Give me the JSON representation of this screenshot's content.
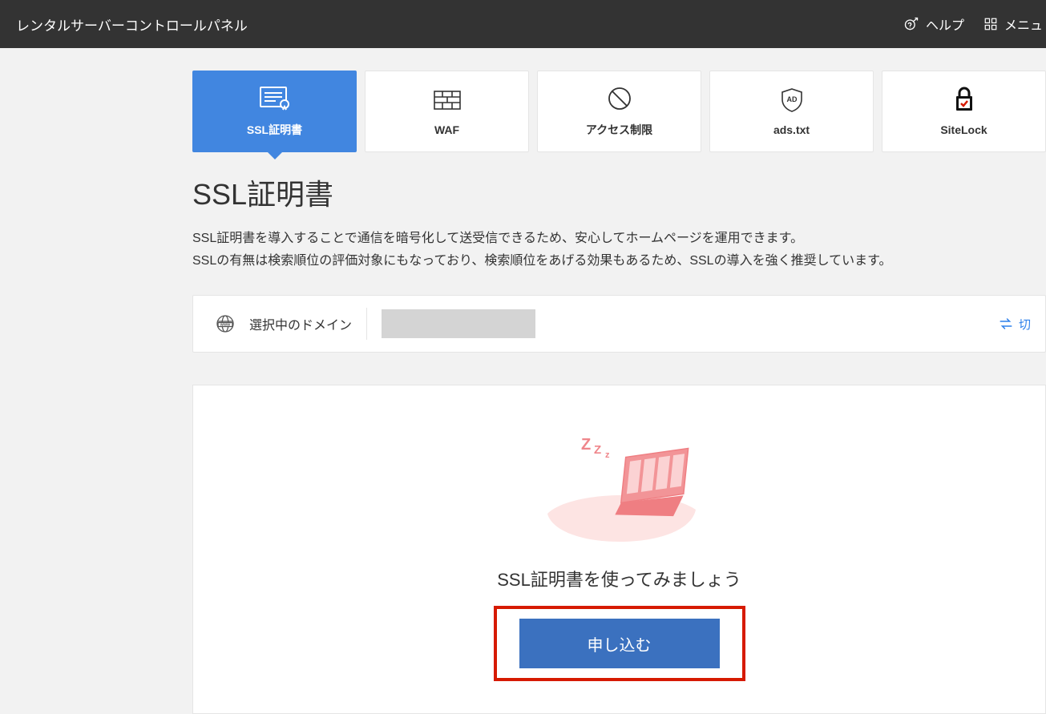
{
  "header": {
    "title": "レンタルサーバーコントロールパネル",
    "help": "ヘルプ",
    "menu": "メニュ"
  },
  "tabs": [
    {
      "label": "SSL証明書"
    },
    {
      "label": "WAF"
    },
    {
      "label": "アクセス制限"
    },
    {
      "label": "ads.txt"
    },
    {
      "label": "SiteLock"
    }
  ],
  "page_title": "SSL証明書",
  "page_desc_line1": "SSL証明書を導入することで通信を暗号化して送受信できるため、安心してホームページを運用できます。",
  "page_desc_line2": "SSLの有無は検索順位の評価対象にもなっており、検索順位をあげる効果もあるため、SSLの導入を強く推奨しています。",
  "domain_bar": {
    "label": "選択中のドメイン",
    "switch": "切"
  },
  "cta": {
    "title": "SSL証明書を使ってみましょう",
    "button": "申し込む"
  }
}
